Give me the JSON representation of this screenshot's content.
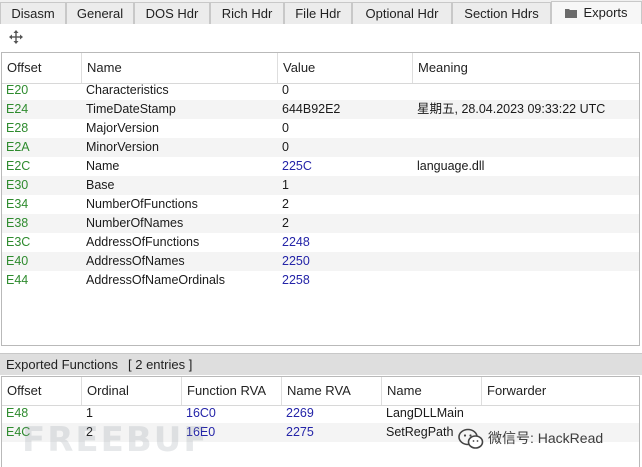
{
  "tabs": [
    {
      "label": "Disasm"
    },
    {
      "label": "General"
    },
    {
      "label": "DOS Hdr"
    },
    {
      "label": "Rich Hdr"
    },
    {
      "label": "File Hdr"
    },
    {
      "label": "Optional Hdr"
    },
    {
      "label": "Section Hdrs"
    },
    {
      "label": "Exports",
      "icon": "folder-icon",
      "active": true
    }
  ],
  "toolbar": {
    "icon": "move-icon"
  },
  "exports_table": {
    "columns": [
      "Offset",
      "Name",
      "Value",
      "Meaning"
    ],
    "rows": [
      {
        "offset": "E20",
        "name": "Characteristics",
        "value": "0",
        "meaning": ""
      },
      {
        "offset": "E24",
        "name": "TimeDateStamp",
        "value": "644B92E2",
        "meaning": "星期五, 28.04.2023 09:33:22 UTC"
      },
      {
        "offset": "E28",
        "name": "MajorVersion",
        "value": "0",
        "meaning": ""
      },
      {
        "offset": "E2A",
        "name": "MinorVersion",
        "value": "0",
        "meaning": ""
      },
      {
        "offset": "E2C",
        "name": "Name",
        "value": "225C",
        "meaning": "language.dll"
      },
      {
        "offset": "E30",
        "name": "Base",
        "value": "1",
        "meaning": ""
      },
      {
        "offset": "E34",
        "name": "NumberOfFunctions",
        "value": "2",
        "meaning": ""
      },
      {
        "offset": "E38",
        "name": "NumberOfNames",
        "value": "2",
        "meaning": ""
      },
      {
        "offset": "E3C",
        "name": "AddressOfFunctions",
        "value": "2248",
        "meaning": ""
      },
      {
        "offset": "E40",
        "name": "AddressOfNames",
        "value": "2250",
        "meaning": ""
      },
      {
        "offset": "E44",
        "name": "AddressOfNameOrdinals",
        "value": "2258",
        "meaning": ""
      }
    ]
  },
  "exported_functions": {
    "title": "Exported Functions",
    "count": "[ 2 entries ]",
    "columns": [
      "Offset",
      "Ordinal",
      "Function RVA",
      "Name RVA",
      "Name",
      "Forwarder"
    ],
    "rows": [
      {
        "offset": "E48",
        "ordinal": "1",
        "function_rva": "16C0",
        "name_rva": "2269",
        "name": "LangDLLMain",
        "forwarder": ""
      },
      {
        "offset": "E4C",
        "ordinal": "2",
        "function_rva": "16E0",
        "name_rva": "2275",
        "name": "SetRegPath",
        "forwarder": ""
      }
    ]
  },
  "watermarks": {
    "left": "FREEBUF",
    "right": "微信号: HackRead"
  },
  "colors": {
    "offset": "#2e8b2e",
    "rva_value": "#2424a8",
    "alt_row": "#f4f4f4",
    "tabbar": "#f0f0f0"
  }
}
